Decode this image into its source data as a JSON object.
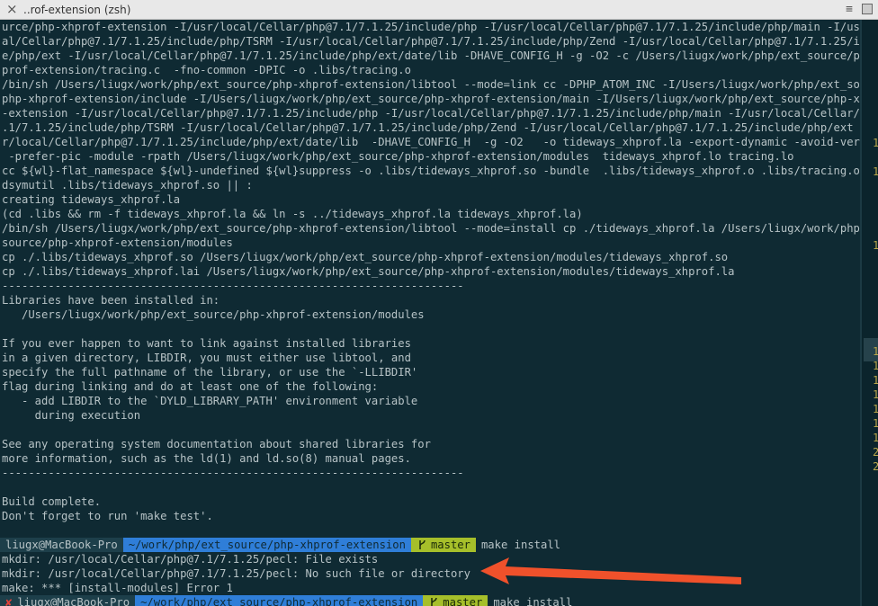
{
  "window": {
    "tab_title": "..rof-extension (zsh)",
    "close_glyph": "×",
    "menu_glyph": "≡"
  },
  "output_lines": [
    "urce/php-xhprof-extension -I/usr/local/Cellar/php@7.1/7.1.25/include/php -I/usr/local/Cellar/php@7.1/7.1.25/include/php/main -I/usr/loc",
    "al/Cellar/php@7.1/7.1.25/include/php/TSRM -I/usr/local/Cellar/php@7.1/7.1.25/include/php/Zend -I/usr/local/Cellar/php@7.1/7.1.25/includ",
    "e/php/ext -I/usr/local/Cellar/php@7.1/7.1.25/include/php/ext/date/lib -DHAVE_CONFIG_H -g -O2 -c /Users/liugx/work/php/ext_source/php-xh",
    "prof-extension/tracing.c  -fno-common -DPIC -o .libs/tracing.o",
    "/bin/sh /Users/liugx/work/php/ext_source/php-xhprof-extension/libtool --mode=link cc -DPHP_ATOM_INC -I/Users/liugx/work/php/ext_source/",
    "php-xhprof-extension/include -I/Users/liugx/work/php/ext_source/php-xhprof-extension/main -I/Users/liugx/work/php/ext_source/php-xhprof",
    "-extension -I/usr/local/Cellar/php@7.1/7.1.25/include/php -I/usr/local/Cellar/php@7.1/7.1.25/include/php/main -I/usr/local/Cellar/php@7",
    ".1/7.1.25/include/php/TSRM -I/usr/local/Cellar/php@7.1/7.1.25/include/php/Zend -I/usr/local/Cellar/php@7.1/7.1.25/include/php/ext -I/us",
    "r/local/Cellar/php@7.1/7.1.25/include/php/ext/date/lib  -DHAVE_CONFIG_H  -g -O2   -o tideways_xhprof.la -export-dynamic -avoid-version",
    " -prefer-pic -module -rpath /Users/liugx/work/php/ext_source/php-xhprof-extension/modules  tideways_xhprof.lo tracing.lo",
    "cc ${wl}-flat_namespace ${wl}-undefined ${wl}suppress -o .libs/tideways_xhprof.so -bundle  .libs/tideways_xhprof.o .libs/tracing.o",
    "dsymutil .libs/tideways_xhprof.so || :",
    "creating tideways_xhprof.la",
    "(cd .libs && rm -f tideways_xhprof.la && ln -s ../tideways_xhprof.la tideways_xhprof.la)",
    "/bin/sh /Users/liugx/work/php/ext_source/php-xhprof-extension/libtool --mode=install cp ./tideways_xhprof.la /Users/liugx/work/php/ext_",
    "source/php-xhprof-extension/modules",
    "cp ./.libs/tideways_xhprof.so /Users/liugx/work/php/ext_source/php-xhprof-extension/modules/tideways_xhprof.so",
    "cp ./.libs/tideways_xhprof.lai /Users/liugx/work/php/ext_source/php-xhprof-extension/modules/tideways_xhprof.la",
    "----------------------------------------------------------------------",
    "Libraries have been installed in:",
    "   /Users/liugx/work/php/ext_source/php-xhprof-extension/modules",
    "",
    "If you ever happen to want to link against installed libraries",
    "in a given directory, LIBDIR, you must either use libtool, and",
    "specify the full pathname of the library, or use the `-LLIBDIR'",
    "flag during linking and do at least one of the following:",
    "   - add LIBDIR to the `DYLD_LIBRARY_PATH' environment variable",
    "     during execution",
    "",
    "See any operating system documentation about shared libraries for",
    "more information, such as the ld(1) and ld.so(8) manual pages.",
    "----------------------------------------------------------------------",
    "",
    "Build complete.",
    "Don't forget to run 'make test'.",
    ""
  ],
  "prompt1": {
    "user": "liugx@MacBook-Pro",
    "path": "~/work/php/ext_source/php-xhprof-extension",
    "branch": "master",
    "command": "make install"
  },
  "error_lines": [
    "mkdir: /usr/local/Cellar/php@7.1/7.1.25/pecl: File exists",
    "mkdir: /usr/local/Cellar/php@7.1/7.1.25/pecl: No such file or directory",
    "make: *** [install-modules] Error 1"
  ],
  "prompt2": {
    "status": "✘",
    "user": "liugx@MacBook-Pro",
    "path": "~/work/php/ext_source/php-xhprof-extension",
    "branch": "master",
    "command": "make install"
  },
  "side_pane_numbers": [
    "1",
    "1",
    "1",
    "1",
    "1",
    "1",
    "1",
    "1",
    "1",
    "1",
    "2",
    "2"
  ],
  "colors": {
    "background": "#0f2a33",
    "text": "#b7c3c6",
    "path_segment": "#2f7ed8",
    "git_segment": "#a6bf2a",
    "annotation_arrow": "#f0512b"
  },
  "icons": {
    "branch": "git-branch-icon",
    "annotation": "red-arrow-icon"
  }
}
